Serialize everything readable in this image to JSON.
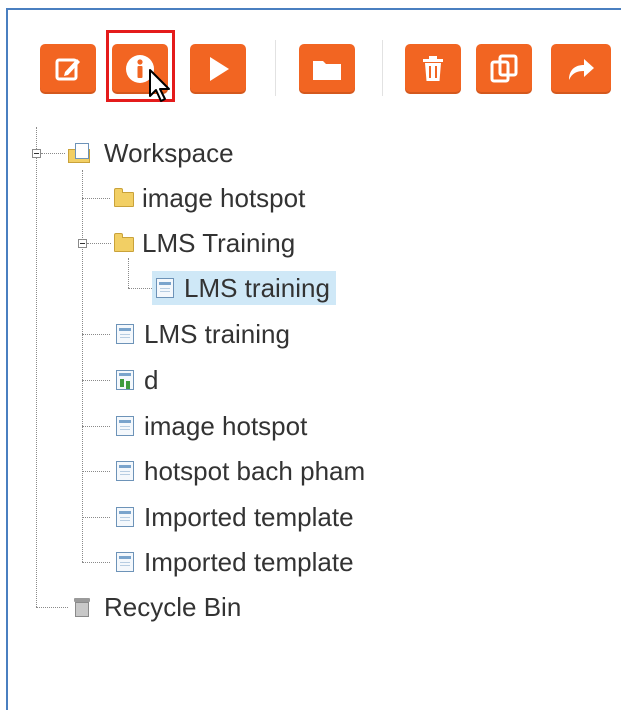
{
  "toolbar": {
    "buttons": [
      {
        "name": "edit-button",
        "icon": "edit-icon"
      },
      {
        "name": "info-button",
        "icon": "info-icon"
      },
      {
        "name": "play-button",
        "icon": "play-icon"
      },
      {
        "name": "folder-button",
        "icon": "folder-icon"
      },
      {
        "name": "delete-button",
        "icon": "trash-icon"
      },
      {
        "name": "copy-button",
        "icon": "copy-icon"
      },
      {
        "name": "share-button",
        "icon": "share-arrow-icon"
      }
    ],
    "accent_color": "#f26522",
    "highlight_color": "#e41b1b"
  },
  "tree": {
    "root": {
      "label": "Workspace",
      "icon": "workspace-icon"
    },
    "items": [
      {
        "label": "image hotspot",
        "icon": "folder-icon"
      },
      {
        "label": "LMS Training",
        "icon": "folder-icon"
      },
      {
        "label": "LMS training",
        "icon": "page-icon",
        "selected": true
      },
      {
        "label": "LMS training",
        "icon": "page-icon"
      },
      {
        "label": "d",
        "icon": "chart-page-icon"
      },
      {
        "label": "image hotspot",
        "icon": "page-icon"
      },
      {
        "label": "hotspot bach pham",
        "icon": "page-icon"
      },
      {
        "label": "Imported template",
        "icon": "page-icon"
      },
      {
        "label": "Imported template",
        "icon": "page-icon"
      }
    ],
    "recycle_bin": {
      "label": "Recycle Bin",
      "icon": "recycle-bin-icon"
    },
    "selected_color": "#cfe8f7"
  }
}
